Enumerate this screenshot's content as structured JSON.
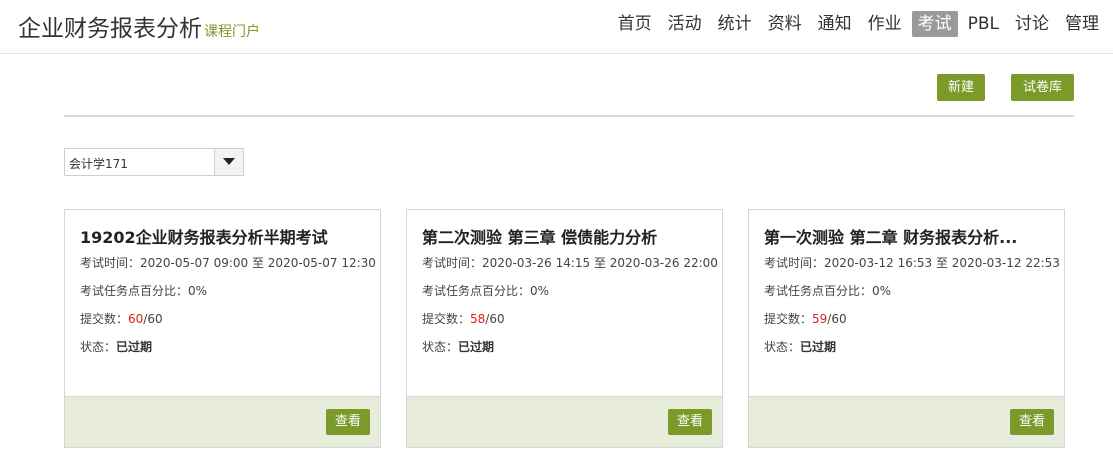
{
  "header": {
    "title": "企业财务报表分析",
    "subtitle": "课程门户",
    "nav": [
      "首页",
      "活动",
      "统计",
      "资料",
      "通知",
      "作业",
      "考试",
      "PBL",
      "讨论",
      "管理"
    ],
    "active_nav": "考试"
  },
  "toolbar": {
    "new_label": "新建",
    "library_label": "试卷库"
  },
  "class_select": {
    "value": "会计学171"
  },
  "labels": {
    "time": "考试时间：",
    "time_sep": " 至 ",
    "pct": "考试任务点百分比：",
    "submit": "提交数：",
    "status": "状态：",
    "view": "查看"
  },
  "exams": [
    {
      "title": "19202企业财务报表分析半期考试",
      "start": "2020-05-07 09:00",
      "end": "2020-05-07 12:30",
      "pct": "0%",
      "submitted": "60",
      "total": "/60",
      "status": "已过期"
    },
    {
      "title": "第二次测验 第三章 偿债能力分析",
      "start": "2020-03-26 14:15",
      "end": "2020-03-26 22:00",
      "pct": "0%",
      "submitted": "58",
      "total": "/60",
      "status": "已过期"
    },
    {
      "title": "第一次测验 第二章 财务报表分析...",
      "start": "2020-03-12 16:53",
      "end": "2020-03-12 22:53",
      "pct": "0%",
      "submitted": "59",
      "total": "/60",
      "status": "已过期"
    }
  ],
  "colors": {
    "accent": "#7c9a2a",
    "footer": "#e8ecda",
    "highlight": "#d9241b",
    "nav_active": "#9a9a9a"
  }
}
